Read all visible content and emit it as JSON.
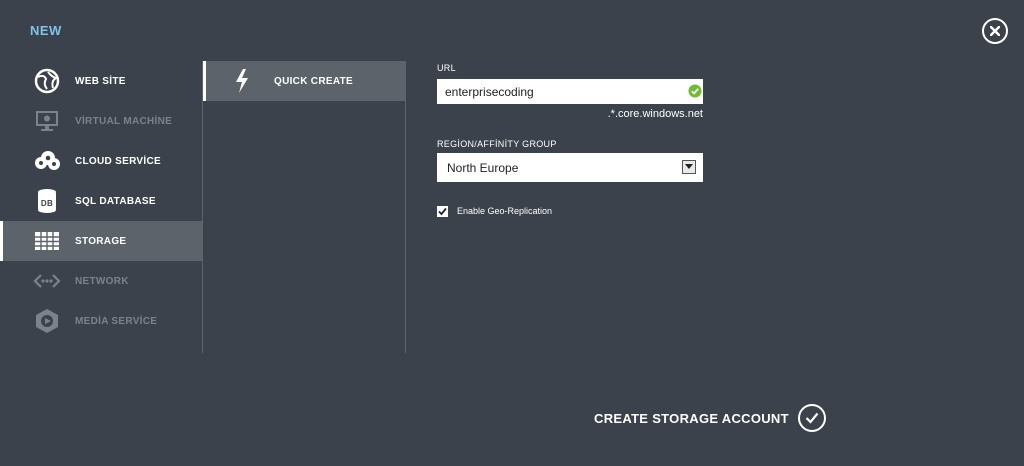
{
  "header": {
    "title": "NEW"
  },
  "categories": [
    {
      "label": "WEB SİTE",
      "icon": "globe-icon",
      "state": "enabled"
    },
    {
      "label": "VİRTUAL MACHİNE",
      "icon": "monitor-icon",
      "state": "disabled"
    },
    {
      "label": "CLOUD SERVİCE",
      "icon": "cloud-icon",
      "state": "enabled"
    },
    {
      "label": "SQL DATABASE",
      "icon": "database-icon",
      "state": "enabled"
    },
    {
      "label": "STORAGE",
      "icon": "grid-table-icon",
      "state": "selected"
    },
    {
      "label": "NETWORK",
      "icon": "network-icon",
      "state": "disabled"
    },
    {
      "label": "MEDİA SERVİCE",
      "icon": "media-icon",
      "state": "disabled"
    }
  ],
  "db_icon_text": "DB",
  "subcategory": {
    "label": "QUICK CREATE",
    "icon": "lightning-icon"
  },
  "form": {
    "url_label": "URL",
    "url_value": "enterprisecoding",
    "url_suffix": ".*.core.windows.net",
    "region_label": "REGİON/AFFİNİTY GROUP",
    "region_value": "North Europe",
    "geo_replication_label": "Enable Geo-Replication",
    "geo_replication_checked": true
  },
  "action": {
    "create_label": "CREATE STORAGE ACCOUNT"
  },
  "colors": {
    "background": "#3b424c",
    "selected": "#5c636b",
    "accent": "#7ec3ea",
    "valid": "#6cbf2a",
    "disabled_text": "#7b828a"
  }
}
